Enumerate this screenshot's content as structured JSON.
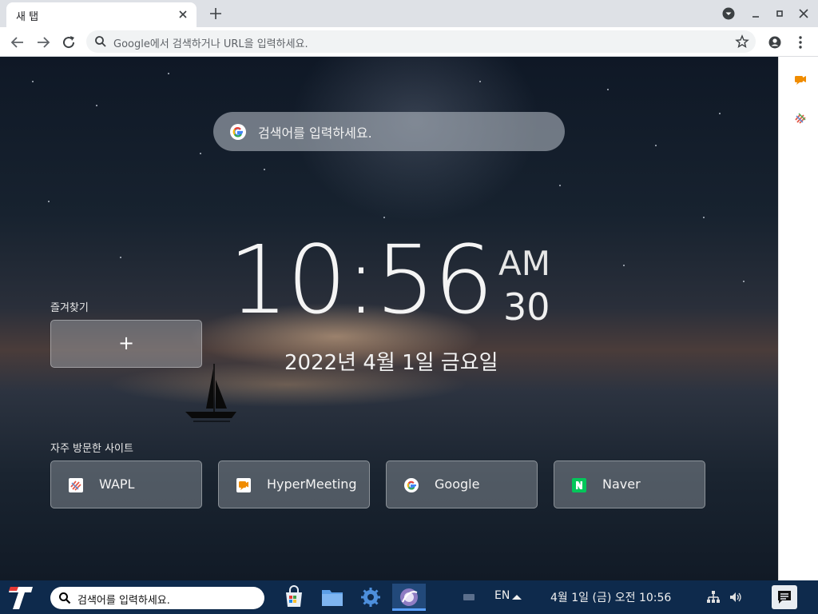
{
  "browser": {
    "tab": {
      "title": "새 탭"
    },
    "omnibox": {
      "placeholder": "Google에서 검색하거나 URL을 입력하세요."
    }
  },
  "ntp": {
    "search_placeholder": "검색어를 입력하세요.",
    "clock": {
      "time": "10:56",
      "ampm": "AM",
      "seconds": "30",
      "date": "2022년 4월 1일 금요일"
    },
    "favorites": {
      "label": "즐겨찾기",
      "add_symbol": "+"
    },
    "frequent": {
      "label": "자주 방문한 사이트",
      "sites": [
        {
          "name": "WAPL",
          "icon": "wapl-icon"
        },
        {
          "name": "HyperMeeting",
          "icon": "hypermeeting-icon"
        },
        {
          "name": "Google",
          "icon": "google-icon"
        },
        {
          "name": "Naver",
          "icon": "naver-icon"
        }
      ]
    }
  },
  "taskbar": {
    "search_placeholder": "검색어를 입력하세요.",
    "language": "EN",
    "datetime": "4월 1일 (금) 오전 10:56"
  },
  "colors": {
    "accent": "#1a73e8",
    "taskbar": "#0e2a4c",
    "naver": "#03c75a",
    "hypermeeting": "#f08c00"
  }
}
